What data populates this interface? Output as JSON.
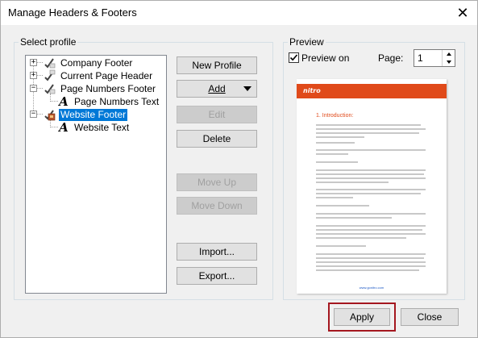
{
  "window": {
    "title": "Manage Headers & Footers",
    "close_glyph": "✕"
  },
  "select_profile": {
    "label": "Select profile",
    "tree": [
      {
        "label": "Company Footer",
        "expander": "+",
        "icon": "footer-profile-icon"
      },
      {
        "label": "Current Page Header",
        "expander": "+",
        "icon": "header-profile-icon"
      },
      {
        "label": "Page Numbers Footer",
        "expander": "−",
        "icon": "footer-profile-icon"
      },
      {
        "label": "Page Numbers Text",
        "icon": "text-a-icon",
        "child": true
      },
      {
        "label": "Website Footer",
        "expander": "−",
        "icon": "website-footer-icon",
        "selected": true
      },
      {
        "label": "Website Text",
        "icon": "text-a-icon",
        "child": true
      }
    ],
    "text_glyph": "A"
  },
  "buttons": {
    "new_profile": "New Profile",
    "add": "Add",
    "edit": "Edit",
    "delete": "Delete",
    "move_up": "Move Up",
    "move_down": "Move Down",
    "import": "Import...",
    "export": "Export...",
    "apply": "Apply",
    "close": "Close"
  },
  "preview": {
    "label": "Preview",
    "preview_on_label": "Preview on",
    "preview_on_checked": true,
    "page_label": "Page:",
    "page_value": "1",
    "document": {
      "brand": "nitro",
      "heading": "1. Introduction:",
      "footer_link": "www.gonitro.com",
      "brand_color": "#e04a1a"
    }
  },
  "colors": {
    "selection": "#0078d7",
    "apply_highlight": "#a4171f"
  }
}
